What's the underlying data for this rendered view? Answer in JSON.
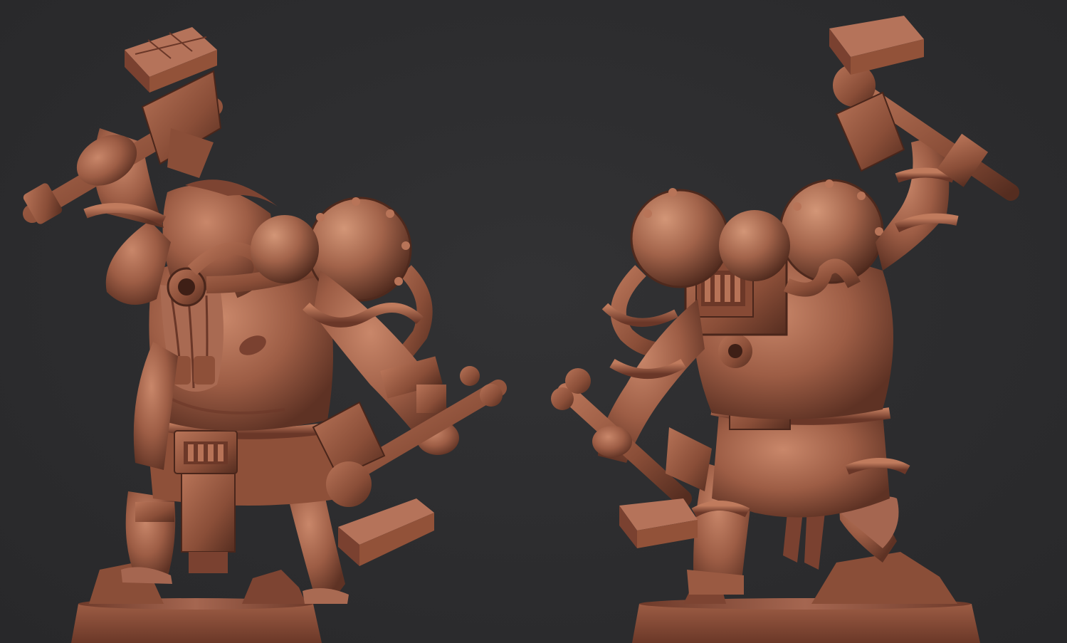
{
  "scene": {
    "background_color": "#2d2d2f",
    "material_base": "#9a5a42",
    "material_light": "#c27d60",
    "material_shadow": "#5e3224",
    "material_deep": "#3e1f16"
  },
  "views": [
    {
      "name": "front-view"
    },
    {
      "name": "back-view"
    }
  ]
}
